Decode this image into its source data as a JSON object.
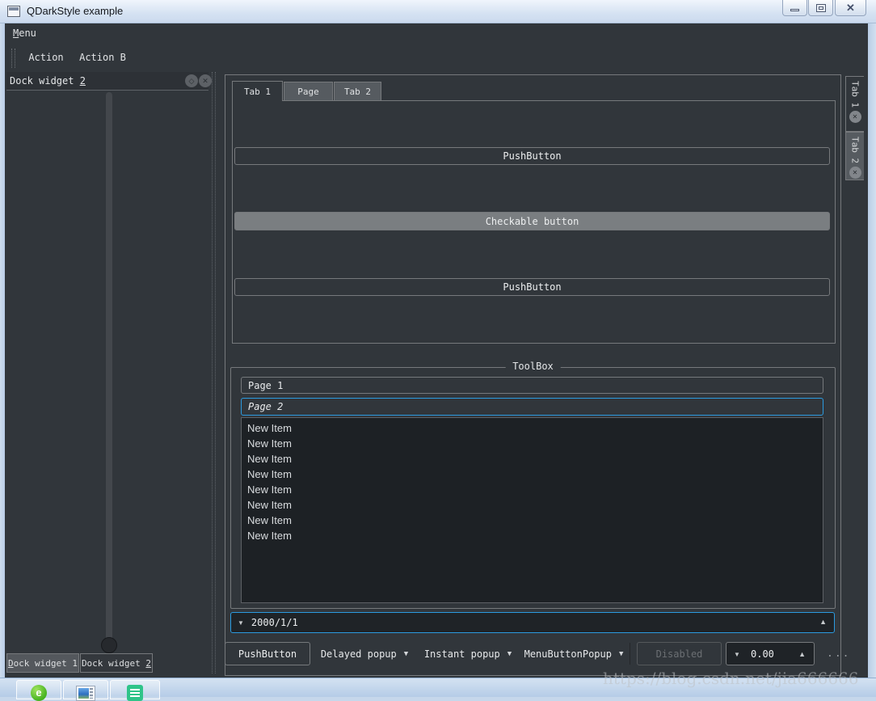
{
  "window": {
    "title": "QDarkStyle example"
  },
  "icons": {
    "close": "✕",
    "float": "◇",
    "dropdown": "▼",
    "spin_up": "▲",
    "spin_down": "▼"
  },
  "menubar": {
    "menu": {
      "pre": "",
      "key": "M",
      "post": "enu"
    }
  },
  "toolbar": {
    "action_a": "Action",
    "action_b": "Action B"
  },
  "dock": {
    "title": {
      "pre": "Dock widget ",
      "key": "2",
      "post": ""
    },
    "tabs": [
      {
        "pre": "",
        "key": "D",
        "post": "ock widget 1",
        "selected": true
      },
      {
        "pre": "Dock widget ",
        "key": "2",
        "post": "",
        "selected": false
      }
    ]
  },
  "main_tabs": [
    {
      "label": "Tab 1",
      "selected": true
    },
    {
      "label": "Page",
      "selected": false
    },
    {
      "label": "Tab 2",
      "selected": false
    }
  ],
  "page": {
    "push_button_1": "PushButton",
    "checkable_button": "Checkable button",
    "push_button_2": "PushButton"
  },
  "toolbox": {
    "group_title": "ToolBox",
    "page1": "Page 1",
    "page2": "Page 2",
    "items": [
      "New Item",
      "New Item",
      "New Item",
      "New Item",
      "New Item",
      "New Item",
      "New Item",
      "New Item"
    ]
  },
  "date_edit": {
    "value": "2000/1/1"
  },
  "bottom_bar": {
    "push_button": "PushButton",
    "delayed_popup": "Delayed popup",
    "instant_popup": "Instant popup",
    "menu_button_popup": "MenuButtonPopup",
    "disabled_button": "Disabled",
    "spin_value": "0.00",
    "overflow": "..."
  },
  "right_tabs": [
    {
      "label": "Tab 1"
    },
    {
      "label": "Tab 2"
    }
  ],
  "watermark": "https://blog.csdn.net/jia666666",
  "colors": {
    "background": "#31363b",
    "surface_dark": "#1f2327",
    "border": "#76797c",
    "accent_blue": "#2b9be0",
    "tab_unselected": "#565b60",
    "checked_button": "#7a7e81",
    "text": "#e8eaec",
    "disabled_text": "#6b6f73",
    "titlebar": "#d5e2f2"
  }
}
